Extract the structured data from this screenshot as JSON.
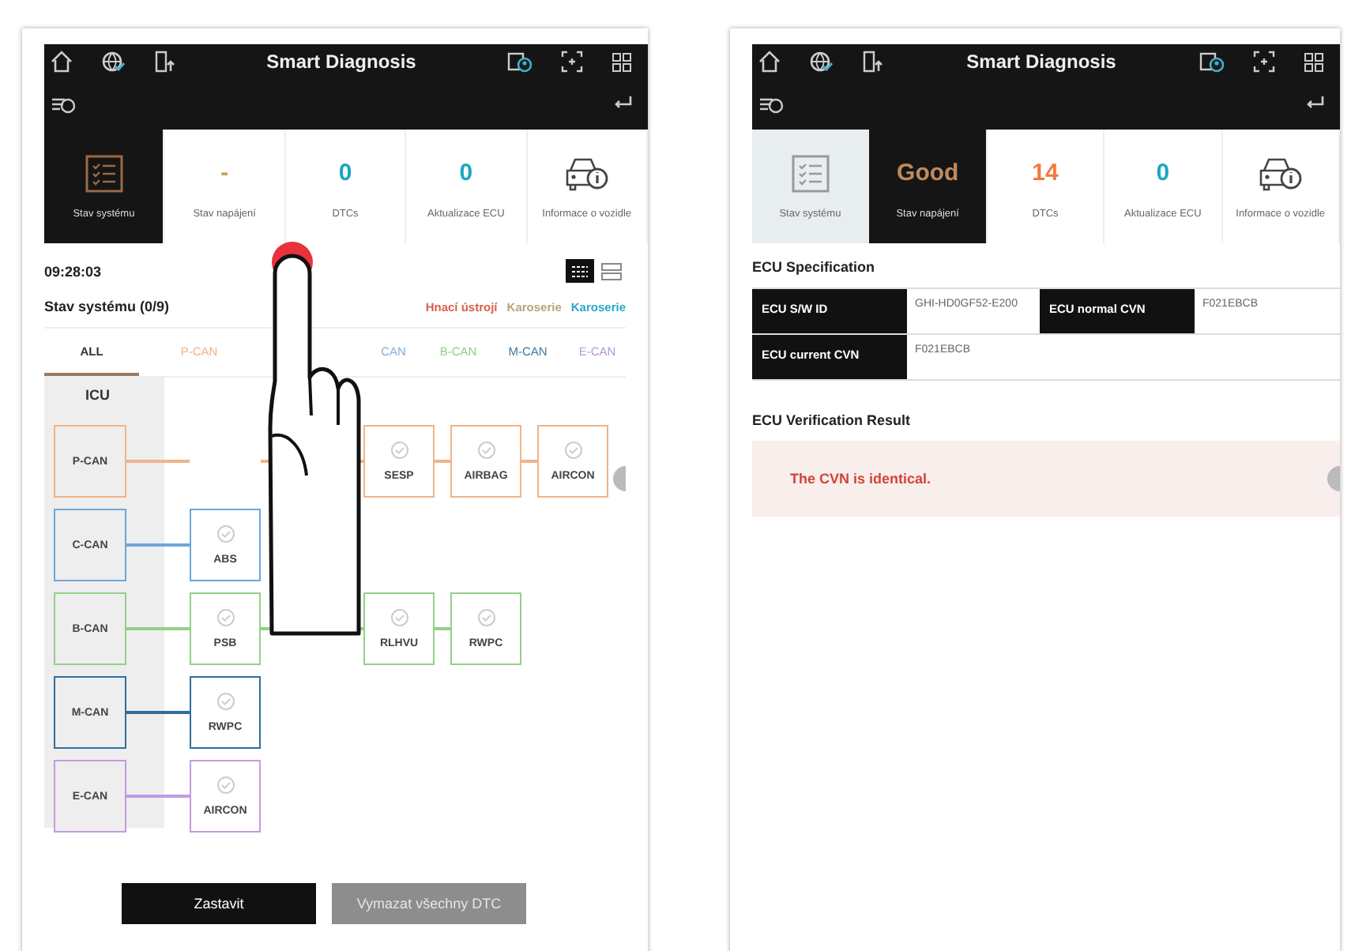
{
  "screens": [
    {
      "kind": "system_status",
      "header": {
        "title": "Smart Diagnosis"
      },
      "tiles": [
        {
          "kind": "status",
          "label": "Stav systému",
          "selected": true
        },
        {
          "kind": "value",
          "label": "Stav napájení",
          "value": "-",
          "color": "#c8a060",
          "selected": false
        },
        {
          "kind": "value",
          "label": "DTCs",
          "value": "0",
          "color": "#1ba6c2",
          "selected": false
        },
        {
          "kind": "value",
          "label": "Aktualizace ECU",
          "value": "0",
          "color": "#1ba6c2",
          "selected": false
        },
        {
          "kind": "info",
          "label": "Informace o vozidle",
          "selected": false
        }
      ],
      "time": "09:28:03",
      "view_toggle": [
        {
          "kind": "diagram",
          "selected": true
        },
        {
          "kind": "list",
          "selected": false
        }
      ],
      "section_title": "Stav systému (0/9)",
      "legend": [
        {
          "label": "Hnací ústrojí",
          "color": "#d9614c"
        },
        {
          "label": "Karoserie",
          "color": "#b8a47a"
        },
        {
          "label": "Karoserie",
          "color": "#2aa7c8"
        }
      ],
      "tabs": [
        {
          "label": "ALL",
          "selected": true,
          "color": "#333333"
        },
        {
          "label": "P-CAN",
          "selected": false,
          "color": "#efb48a"
        },
        {
          "label": "CAN",
          "selected": false,
          "color": "#7fb0dd"
        },
        {
          "label": "B-CAN",
          "selected": false,
          "color": "#90cc88"
        },
        {
          "label": "M-CAN",
          "selected": false,
          "color": "#3a7aa6"
        },
        {
          "label": "E-CAN",
          "selected": false,
          "color": "#b897d6"
        }
      ],
      "icu_label": "ICU",
      "buses": [
        {
          "label": "P-CAN",
          "color": "#f0b48a",
          "nodes": [
            {
              "kind": "hidden"
            },
            {
              "kind": "hidden"
            },
            {
              "kind": "ecu",
              "label": "SESP"
            },
            {
              "kind": "ecu",
              "label": "AIRBAG"
            },
            {
              "kind": "ecu",
              "label": "AIRCON"
            }
          ]
        },
        {
          "label": "C-CAN",
          "color": "#6fa6d8",
          "nodes": [
            {
              "kind": "ecu",
              "label": "ABS"
            }
          ]
        },
        {
          "label": "B-CAN",
          "color": "#93d089",
          "nodes": [
            {
              "kind": "ecu",
              "label": "PSB"
            },
            {
              "kind": "hidden"
            },
            {
              "kind": "ecu",
              "label": "RLHVU"
            },
            {
              "kind": "ecu",
              "label": "RWPC"
            }
          ]
        },
        {
          "label": "M-CAN",
          "color": "#2f6e9c",
          "nodes": [
            {
              "kind": "ecu",
              "label": "RWPC"
            }
          ]
        },
        {
          "label": "E-CAN",
          "color": "#c29be0",
          "nodes": [
            {
              "kind": "ecu",
              "label": "AIRCON"
            }
          ]
        }
      ],
      "buttons": [
        {
          "label": "Zastavit",
          "disabled": false
        },
        {
          "label": "Vymazat všechny DTC",
          "disabled": true
        }
      ]
    },
    {
      "kind": "ecu_spec",
      "header": {
        "title": "Smart Diagnosis"
      },
      "tiles": [
        {
          "kind": "status",
          "label": "Stav systému",
          "selected": false
        },
        {
          "kind": "value",
          "label": "Stav napájení",
          "value": "Good",
          "color": "#c08a5a",
          "selected": true
        },
        {
          "kind": "value",
          "label": "DTCs",
          "value": "14",
          "color": "#f07a3c",
          "selected": false
        },
        {
          "kind": "value",
          "label": "Aktualizace ECU",
          "value": "0",
          "color": "#1ba6c2",
          "selected": false
        },
        {
          "kind": "info",
          "label": "Informace o vozidle",
          "selected": false
        }
      ],
      "spec_title": "ECU Specification",
      "spec_rows": [
        [
          {
            "label": "ECU S/W ID",
            "value": "GHI-HD0GF52-E200"
          },
          {
            "label": "ECU normal CVN",
            "value": "F021EBCB"
          }
        ],
        [
          {
            "label": "ECU current CVN",
            "value": "F021EBCB"
          }
        ]
      ],
      "result_title": "ECU Verification Result",
      "result_message": "The CVN is identical."
    }
  ]
}
